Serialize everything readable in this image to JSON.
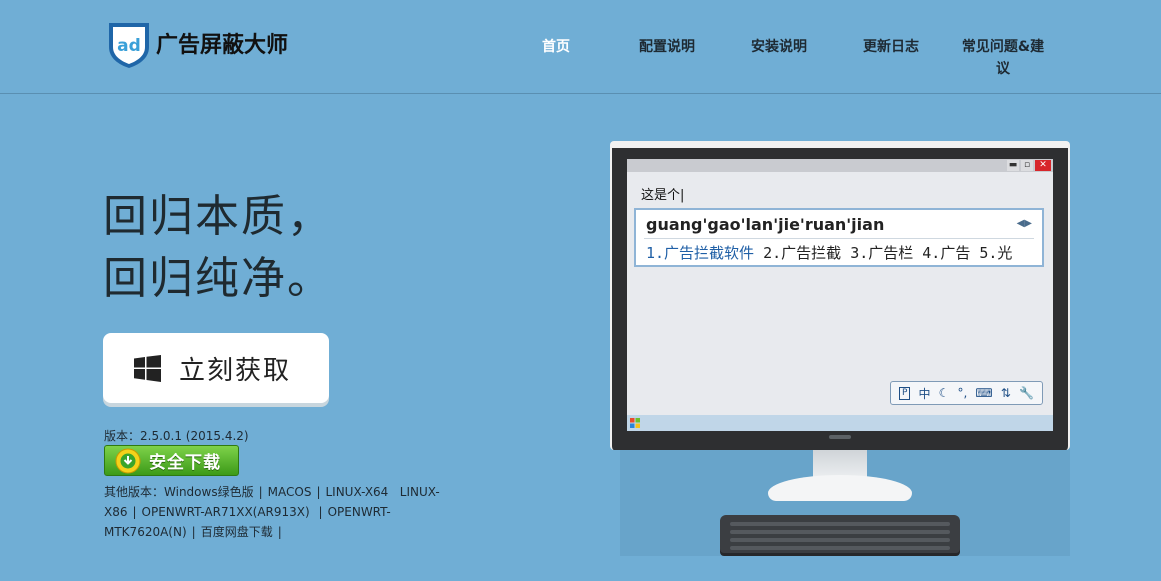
{
  "brand": {
    "logo_mark": "ad",
    "name": "广告屏蔽大师"
  },
  "nav": {
    "items": [
      {
        "label": "首页",
        "active": true
      },
      {
        "label": "配置说明",
        "active": false
      },
      {
        "label": "安装说明",
        "active": false
      },
      {
        "label": "更新日志",
        "active": false
      },
      {
        "label": "常见问题&建议",
        "active": false
      }
    ]
  },
  "hero": {
    "slogan_line1": "回归本质，",
    "slogan_line2": "回归纯净。",
    "get_button_label": "立刻获取",
    "version_text": "版本：2.5.0.1 (2015.4.2)",
    "download_button_label": "安全下载",
    "other_versions_prefix": "其他版本：",
    "other_versions": [
      "Windows绿色版",
      "MACOS",
      "LINUX-X64",
      "LINUX-X86",
      "OPENWRT-AR71XX(AR913X)",
      "OPENWRT-MTK7620A(N)",
      "百度网盘下载"
    ]
  },
  "demo": {
    "typed_text": "这是个|",
    "pinyin": "guang'gao'lan'jie'ruan'jian",
    "candidates": [
      "1.广告拦截软件",
      "2.广告拦截",
      "3.广告栏",
      "4.广告",
      "5.光"
    ],
    "toolbar_lang": "中"
  },
  "colors": {
    "background": "#70aed5",
    "nav_active": "#ffffff",
    "download_green": "#4caf1e",
    "ime_first_candidate": "#1f5fa6"
  }
}
